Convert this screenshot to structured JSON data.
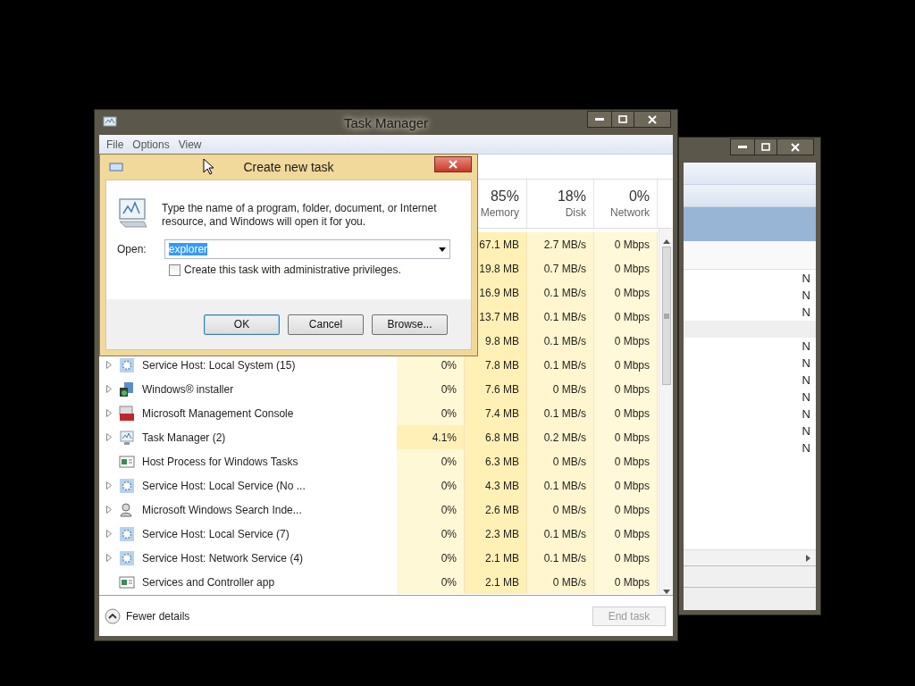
{
  "back_window": {
    "rows": [
      {
        "kind": "highlight"
      },
      {
        "kind": "header"
      },
      {
        "kind": "item",
        "column_1": "N"
      },
      {
        "kind": "item",
        "column_1": "N"
      },
      {
        "kind": "item",
        "column_1": "N"
      },
      {
        "kind": "group"
      },
      {
        "kind": "item",
        "column_1": "N"
      },
      {
        "kind": "item",
        "column_1": "N"
      },
      {
        "kind": "item",
        "column_1": "N"
      },
      {
        "kind": "item",
        "column_1": "N"
      },
      {
        "kind": "item",
        "column_1": "N"
      },
      {
        "kind": "item",
        "column_1": "N"
      },
      {
        "kind": "item",
        "column_1": "N"
      }
    ]
  },
  "task_manager": {
    "title": "Task Manager",
    "menu": [
      "File",
      "Options",
      "View"
    ],
    "columns": [
      {
        "percent": "85%",
        "label": "Memory"
      },
      {
        "percent": "18%",
        "label": "Disk"
      },
      {
        "percent": "0%",
        "label": "Network"
      }
    ],
    "rows": [
      {
        "memory": "67.1 MB",
        "disk": "2.7 MB/s",
        "network": "0 Mbps"
      },
      {
        "memory": "19.8 MB",
        "disk": "0.7 MB/s",
        "network": "0 Mbps"
      },
      {
        "memory": "16.9 MB",
        "disk": "0.1 MB/s",
        "network": "0 Mbps"
      },
      {
        "memory": "13.7 MB",
        "disk": "0.1 MB/s",
        "network": "0 Mbps"
      },
      {
        "memory": "9.8 MB",
        "disk": "0.1 MB/s",
        "network": "0 Mbps"
      },
      {
        "kind": "service",
        "expandable": true,
        "name": "Service Host: Local System (15)",
        "cpu": "0%",
        "memory": "7.8 MB",
        "disk": "0.1 MB/s",
        "network": "0 Mbps"
      },
      {
        "kind": "installer",
        "expandable": true,
        "name": "Windows® installer",
        "cpu": "0%",
        "memory": "7.6 MB",
        "disk": "0 MB/s",
        "network": "0 Mbps"
      },
      {
        "kind": "console",
        "expandable": true,
        "name": "Microsoft Management Console",
        "cpu": "0%",
        "memory": "7.4 MB",
        "disk": "0.1 MB/s",
        "network": "0 Mbps"
      },
      {
        "kind": "monitor",
        "expandable": true,
        "name": "Task Manager (2)",
        "cpu": "4.1%",
        "memory": "6.8 MB",
        "disk": "0.2 MB/s",
        "network": "0 Mbps"
      },
      {
        "kind": "window",
        "expandable": false,
        "name": "Host Process for Windows Tasks",
        "cpu": "0%",
        "memory": "6.3 MB",
        "disk": "0 MB/s",
        "network": "0 Mbps"
      },
      {
        "kind": "service",
        "expandable": true,
        "name": "Service Host: Local Service (No ...",
        "cpu": "0%",
        "memory": "4.3 MB",
        "disk": "0.1 MB/s",
        "network": "0 Mbps"
      },
      {
        "kind": "search",
        "expandable": true,
        "name": "Microsoft Windows Search Inde...",
        "cpu": "0%",
        "memory": "2.6 MB",
        "disk": "0 MB/s",
        "network": "0 Mbps"
      },
      {
        "kind": "service",
        "expandable": true,
        "name": "Service Host: Local Service (7)",
        "cpu": "0%",
        "memory": "2.3 MB",
        "disk": "0.1 MB/s",
        "network": "0 Mbps"
      },
      {
        "kind": "service",
        "expandable": true,
        "name": "Service Host: Network Service (4)",
        "cpu": "0%",
        "memory": "2.1 MB",
        "disk": "0.1 MB/s",
        "network": "0 Mbps"
      },
      {
        "kind": "window",
        "expandable": false,
        "name": "Services and Controller app",
        "cpu": "0%",
        "memory": "2.1 MB",
        "disk": "0 MB/s",
        "network": "0 Mbps"
      }
    ],
    "footer": {
      "toggle": "Fewer details",
      "end_task": {
        "label": "End task",
        "disabled": true
      }
    }
  },
  "dialog": {
    "title": "Create new task",
    "message": "Type the name of a program, folder, document, or Internet resource, and Windows will open it for you.",
    "open_label": "Open:",
    "open_value": "explorer",
    "value_selected": true,
    "checkbox": {
      "label": "Create this task with administrative privileges.",
      "checked": false
    },
    "buttons": [
      {
        "label": "OK",
        "default": true
      },
      {
        "label": "Cancel",
        "default": false
      },
      {
        "label": "Browse...",
        "default": false
      }
    ]
  }
}
